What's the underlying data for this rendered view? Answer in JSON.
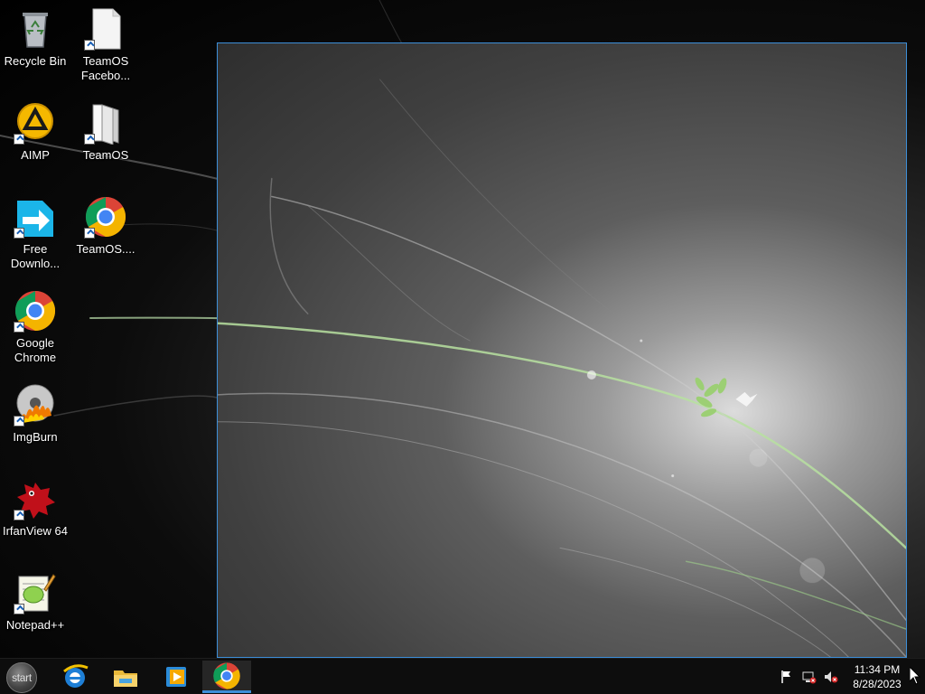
{
  "desktop": {
    "icons": [
      {
        "label": "Recycle Bin",
        "icon": "recycle-bin-icon"
      },
      {
        "label": "TeamOS Facebo...",
        "icon": "document-icon"
      },
      {
        "label": "AIMP",
        "icon": "aimp-icon"
      },
      {
        "label": "TeamOS",
        "icon": "folder-icon"
      },
      {
        "label": "Free Downlo...",
        "icon": "free-download-manager-icon"
      },
      {
        "label": "TeamOS....",
        "icon": "chrome-icon"
      },
      {
        "label": "Google Chrome",
        "icon": "chrome-icon"
      },
      {
        "label": "ImgBurn",
        "icon": "imgburn-icon"
      },
      {
        "label": "IrfanView 64",
        "icon": "irfanview-icon"
      },
      {
        "label": "Notepad++",
        "icon": "notepadpp-icon"
      }
    ]
  },
  "taskbar": {
    "start_label": "start",
    "pinned": [
      "internet-explorer-icon",
      "file-explorer-icon",
      "media-player-icon",
      "chrome-icon"
    ],
    "clock": {
      "time": "11:34 PM",
      "date": "8/28/2023"
    },
    "accent_color": "#3c8ed8"
  }
}
